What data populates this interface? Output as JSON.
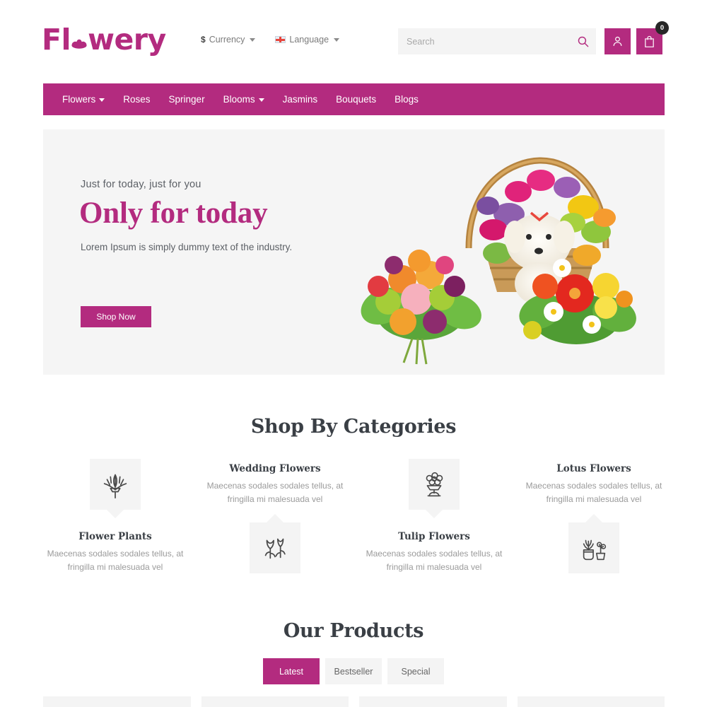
{
  "site": {
    "logo_text_before": "Fl",
    "logo_icon": "lotus-flower-icon",
    "logo_text_after": "wery",
    "brand_color": "#b32b7f",
    "heading_color": "#3a3f45",
    "muted_color": "#9b9b9b",
    "panel_bg": "#f4f4f4"
  },
  "header": {
    "currency": {
      "symbol": "$",
      "label": "Currency",
      "caret": "chevron-down-icon"
    },
    "language": {
      "flag": "uk-flag-icon",
      "label": "Language",
      "caret": "chevron-down-icon"
    },
    "search": {
      "placeholder": "Search",
      "value": "",
      "icon": "search-icon"
    },
    "account_icon": "user-icon",
    "cart_icon": "shopping-bag-icon",
    "cart_count": "0"
  },
  "nav": {
    "items": [
      {
        "label": "Flowers",
        "has_dropdown": true
      },
      {
        "label": "Roses",
        "has_dropdown": false
      },
      {
        "label": "Springer",
        "has_dropdown": false
      },
      {
        "label": "Blooms",
        "has_dropdown": true
      },
      {
        "label": "Jasmins",
        "has_dropdown": false
      },
      {
        "label": "Bouquets",
        "has_dropdown": false
      },
      {
        "label": "Blogs",
        "has_dropdown": false
      }
    ]
  },
  "hero": {
    "subtitle": "Just for today, just for you",
    "title": "Only for today",
    "description": "Lorem Ipsum is simply dummy text of the  industry.",
    "cta_label": "Shop Now",
    "image_alt": "flower-bouquet-basket-photo"
  },
  "categories_section": {
    "title": "Shop By Categories",
    "items": [
      {
        "name": "Flower Plants",
        "description": "Maecenas sodales sodales tellus, at fringilla mi malesuada vel",
        "icon": "flower-stem-icon",
        "layout": "icon-top"
      },
      {
        "name": "Wedding Flowers",
        "description": "Maecenas sodales sodales tellus, at fringilla mi malesuada vel",
        "icon": "tulips-icon",
        "layout": "icon-bottom"
      },
      {
        "name": "Tulip Flowers",
        "description": "Maecenas sodales sodales tellus, at fringilla mi malesuada vel",
        "icon": "bouquet-vase-icon",
        "layout": "icon-top"
      },
      {
        "name": "Lotus Flowers",
        "description": "Maecenas sodales sodales tellus, at fringilla mi malesuada vel",
        "icon": "potted-plants-icon",
        "layout": "icon-bottom"
      }
    ]
  },
  "products_section": {
    "title": "Our Products",
    "tabs": [
      {
        "label": "Latest",
        "active": true
      },
      {
        "label": "Bestseller",
        "active": false
      },
      {
        "label": "Special",
        "active": false
      }
    ],
    "cards": [
      {},
      {},
      {},
      {}
    ]
  }
}
